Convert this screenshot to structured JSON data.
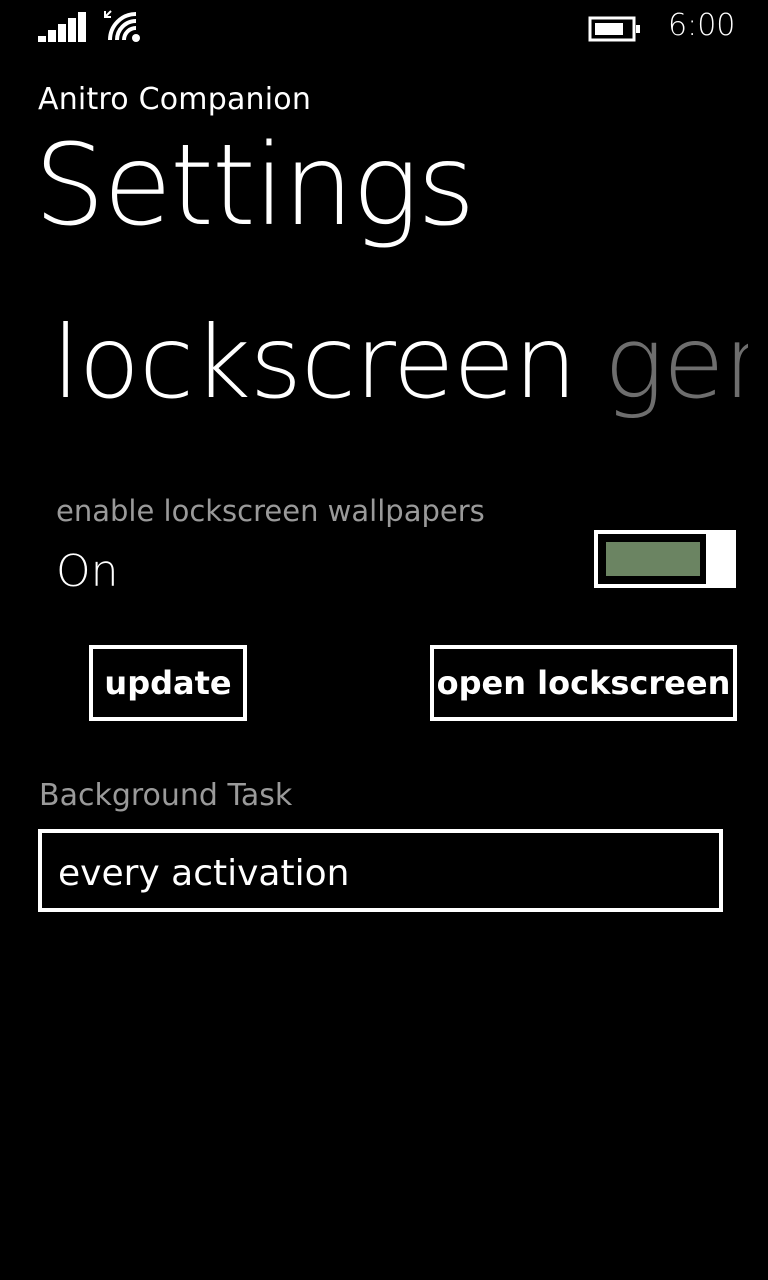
{
  "status_bar": {
    "signal_icon": "signal-strength-icon",
    "wifi_icon": "wifi-icon",
    "battery_icon": "battery-icon",
    "time": "6:00"
  },
  "header": {
    "app_title": "Anitro Companion",
    "page_title": "Settings"
  },
  "pivot": {
    "active": "lockscreen",
    "next_partial": "gen"
  },
  "lockscreen": {
    "toggle_label": "enable lockscreen wallpapers",
    "toggle_state": "On",
    "toggle_on": true,
    "toggle_color": "#6b8462",
    "update_label": "update",
    "open_label": "open lockscreen",
    "background_task_label": "Background Task",
    "background_task_value": "every activation"
  }
}
